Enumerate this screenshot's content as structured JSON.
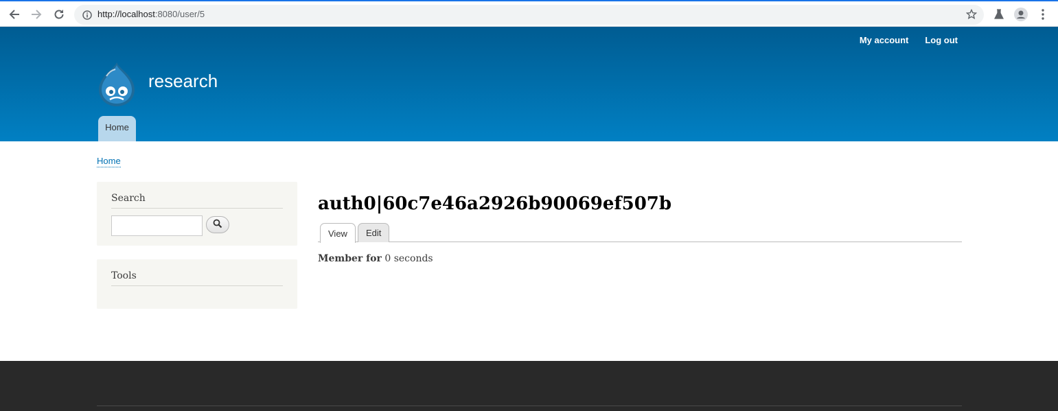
{
  "browser": {
    "url_host": "http://localhost",
    "url_rest": ":8080/user/5"
  },
  "header": {
    "site_name": "research",
    "secondary_menu": [
      "My account",
      "Log out"
    ],
    "main_menu": [
      "Home"
    ]
  },
  "breadcrumb": [
    "Home"
  ],
  "sidebar": {
    "search_title": "Search",
    "search_value": "",
    "tools_title": "Tools"
  },
  "main": {
    "title": "auth0|60c7e46a2926b90069ef507b",
    "tabs": [
      {
        "label": "View",
        "active": true
      },
      {
        "label": "Edit",
        "active": false
      }
    ],
    "member_label": "Member for",
    "member_value": "0 seconds"
  },
  "colors": {
    "header_top": "#005c92",
    "header_bottom": "#0180c3",
    "link": "#0071b3",
    "footer": "#292929"
  },
  "icons": [
    "back-icon",
    "forward-icon",
    "reload-icon",
    "info-icon",
    "star-icon",
    "lab-icon",
    "profile-icon",
    "menu-icon",
    "drupal-logo",
    "search-icon"
  ]
}
